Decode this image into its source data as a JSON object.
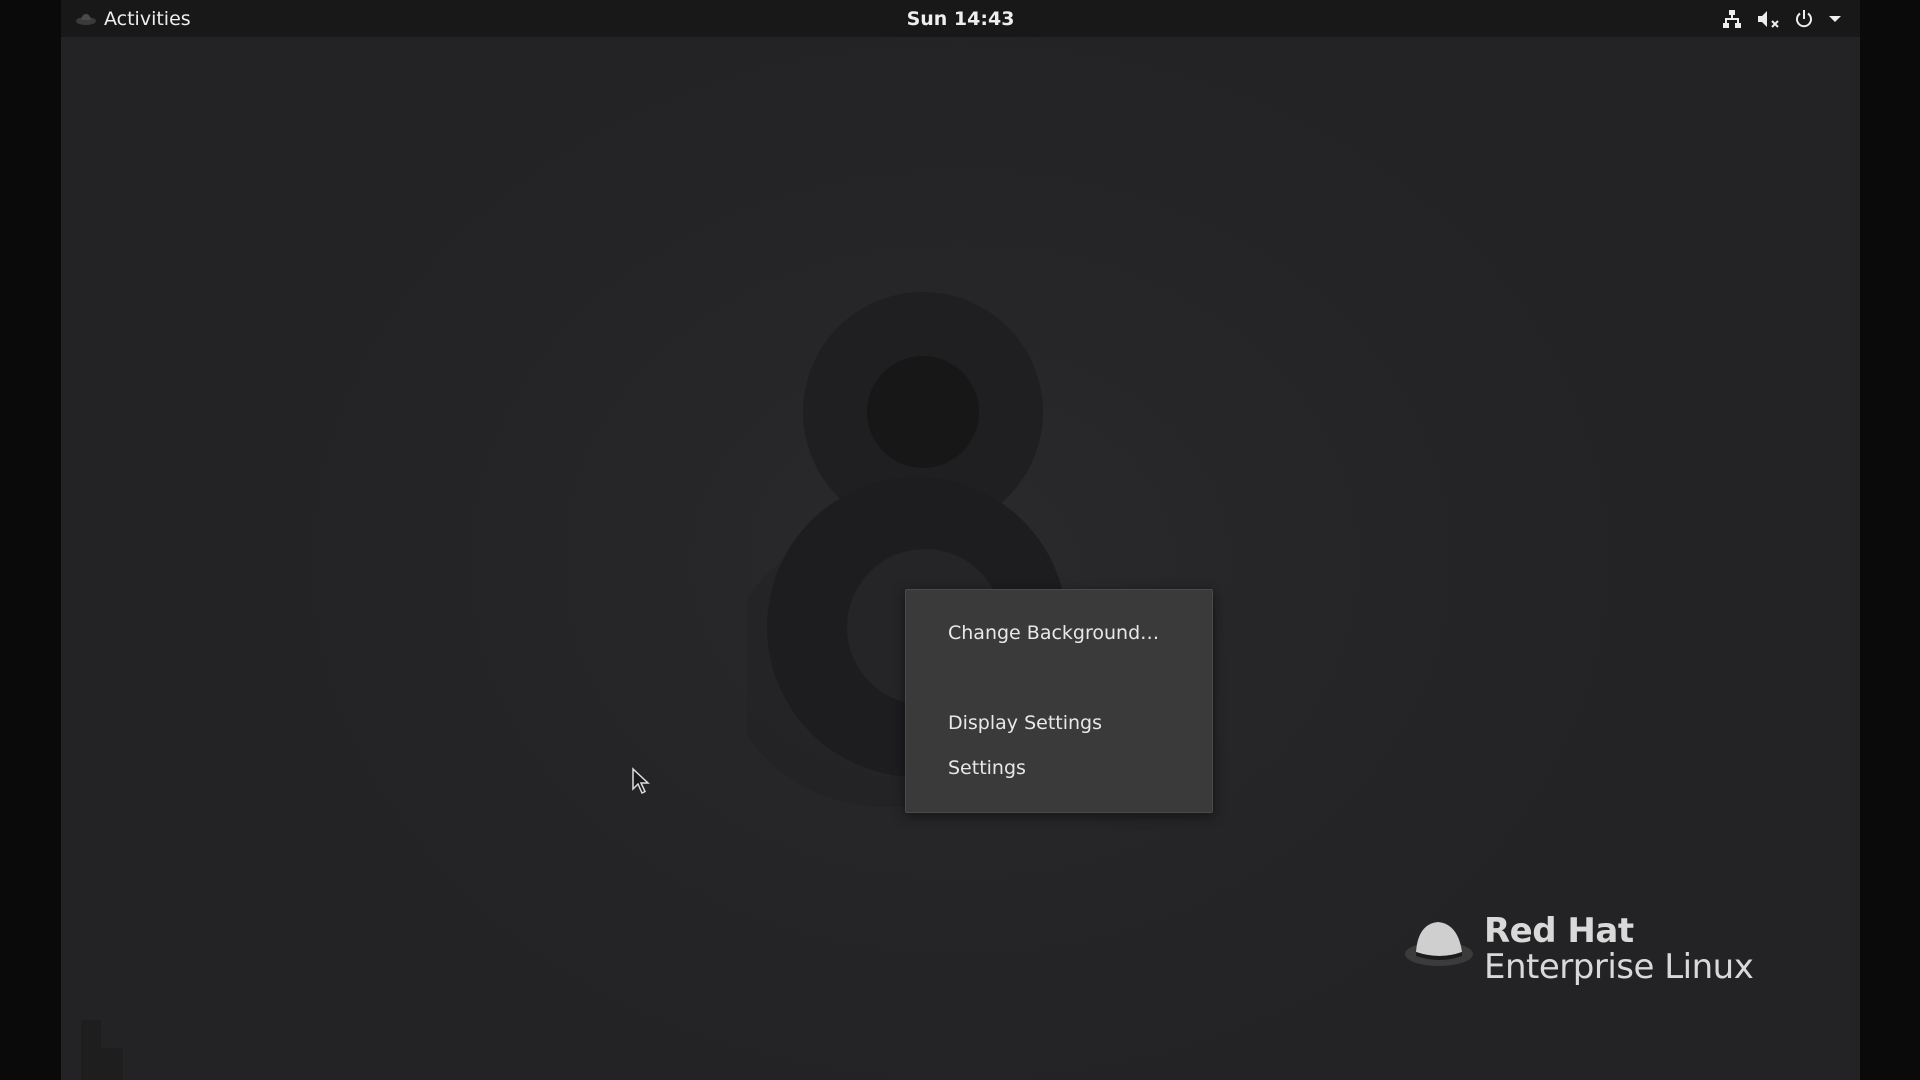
{
  "top_bar": {
    "activities_label": "Activities",
    "clock": "Sun 14:43",
    "tray_icons": [
      "network-wired-icon",
      "audio-muted-icon",
      "power-icon",
      "chevron-down-icon"
    ]
  },
  "context_menu": {
    "items": [
      {
        "label": "Change Background…"
      },
      {
        "label": "Display Settings"
      },
      {
        "label": "Settings"
      }
    ]
  },
  "wallpaper": {
    "version_mark": "8"
  },
  "brand": {
    "line1": "Red Hat",
    "line2": "Enterprise Linux"
  },
  "colors": {
    "desktop_bg": "#262628",
    "top_bar_bg": "#181818",
    "menu_bg": "#3a3a3a",
    "text": "#eeeeec"
  }
}
